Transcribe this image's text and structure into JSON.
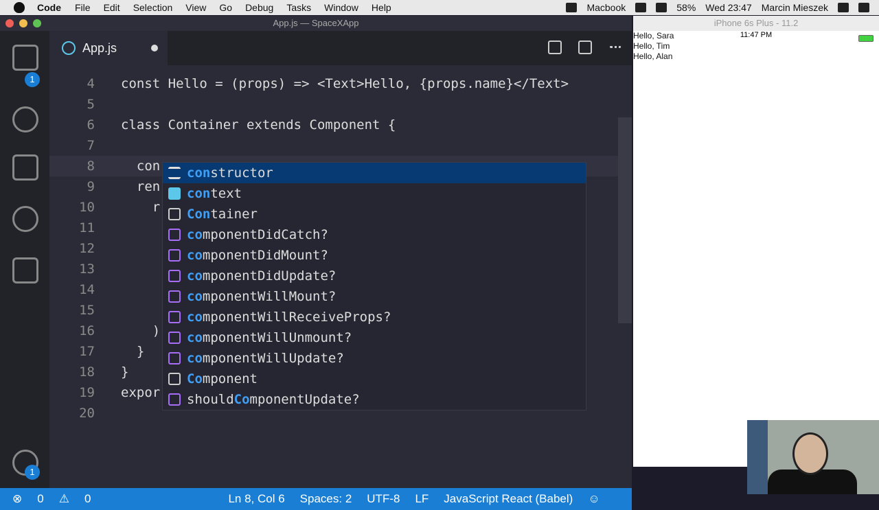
{
  "menubar": {
    "app": "Code",
    "items": [
      "File",
      "Edit",
      "Selection",
      "View",
      "Go",
      "Debug",
      "Tasks",
      "Window",
      "Help"
    ],
    "right": {
      "device": "Macbook",
      "battery": "58%",
      "clock": "Wed 23:47",
      "user": "Marcin Mieszek"
    }
  },
  "window": {
    "title": "App.js — SpaceXApp"
  },
  "tabs": [
    {
      "label": "App.js"
    }
  ],
  "activity": {
    "explorer_badge": "1",
    "settings_badge": "1"
  },
  "editor": {
    "lines": [
      {
        "n": "4",
        "text": "const Hello = (props) => <Text>Hello, {props.name}</Text>"
      },
      {
        "n": "5",
        "text": ""
      },
      {
        "n": "6",
        "text": "class Container extends Component {"
      },
      {
        "n": "7",
        "text": ""
      },
      {
        "n": "8",
        "text": "  con"
      },
      {
        "n": "9",
        "text": "  ren"
      },
      {
        "n": "10",
        "text": "    r"
      },
      {
        "n": "11",
        "text": ""
      },
      {
        "n": "12",
        "text": ""
      },
      {
        "n": "13",
        "text": ""
      },
      {
        "n": "14",
        "text": ""
      },
      {
        "n": "15",
        "text": ""
      },
      {
        "n": "16",
        "text": "    )"
      },
      {
        "n": "17",
        "text": "  }"
      },
      {
        "n": "18",
        "text": "}"
      },
      {
        "n": "19",
        "text": "expor"
      },
      {
        "n": "20",
        "text": ""
      }
    ]
  },
  "suggestions": [
    {
      "label": "constructor",
      "icon": "keyword",
      "hl": "con"
    },
    {
      "label": "context",
      "icon": "variable",
      "hl": "con"
    },
    {
      "label": "Container",
      "icon": "file",
      "hl": "Con"
    },
    {
      "label": "componentDidCatch?",
      "icon": "method",
      "hl": "co"
    },
    {
      "label": "componentDidMount?",
      "icon": "method",
      "hl": "co"
    },
    {
      "label": "componentDidUpdate?",
      "icon": "method",
      "hl": "co"
    },
    {
      "label": "componentWillMount?",
      "icon": "method",
      "hl": "co"
    },
    {
      "label": "componentWillReceiveProps?",
      "icon": "method",
      "hl": "co"
    },
    {
      "label": "componentWillUnmount?",
      "icon": "method",
      "hl": "co"
    },
    {
      "label": "componentWillUpdate?",
      "icon": "method",
      "hl": "co"
    },
    {
      "label": "Component",
      "icon": "file",
      "hl": "Co"
    },
    {
      "label": "shouldComponentUpdate?",
      "icon": "method",
      "hl": "Co"
    }
  ],
  "statusbar": {
    "errors": "0",
    "warnings": "0",
    "position": "Ln 8, Col 6",
    "spaces": "Spaces: 2",
    "encoding": "UTF-8",
    "eol": "LF",
    "language": "JavaScript React (Babel)"
  },
  "simulator": {
    "title": "iPhone 6s Plus - 11.2",
    "time": "11:47 PM",
    "hellos": [
      "Hello, Sara",
      "Hello, Tim",
      "Hello, Alan"
    ]
  },
  "colors": {
    "status_blue": "#1a7fd4",
    "selection": "#073a72"
  }
}
